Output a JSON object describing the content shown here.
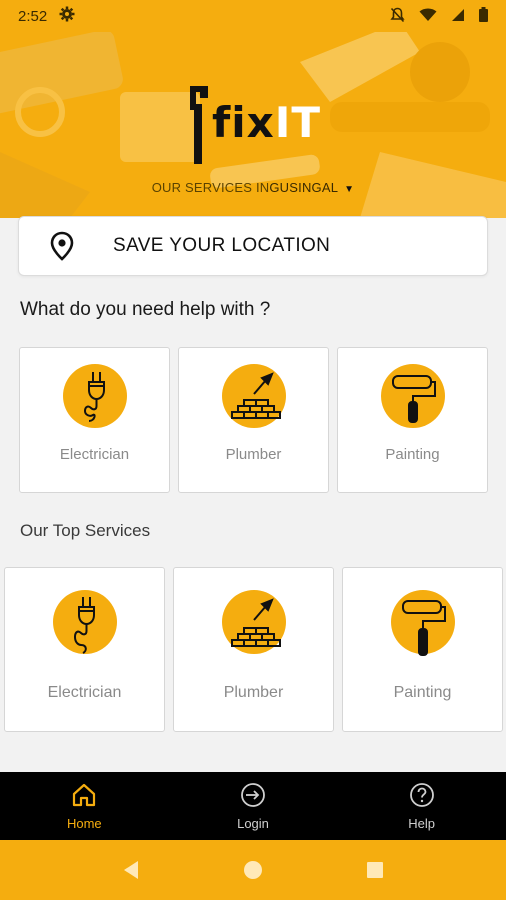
{
  "status_bar": {
    "time": "2:52"
  },
  "brand": {
    "logo_fix": "fix",
    "logo_it": "IT"
  },
  "city": {
    "prefix": "OUR SERVICES IN",
    "name": "GUSINGAL"
  },
  "location": {
    "label": "SAVE YOUR LOCATION"
  },
  "help_section": {
    "title": "What do you need help with ?",
    "items": [
      {
        "label": "Electrician",
        "icon": "plug-icon"
      },
      {
        "label": "Plumber",
        "icon": "trowel-bricks-icon"
      },
      {
        "label": "Painting",
        "icon": "paint-roller-icon"
      }
    ]
  },
  "top_services": {
    "title": "Our Top Services",
    "items": [
      {
        "label": "Electrician",
        "icon": "plug-icon"
      },
      {
        "label": "Plumber",
        "icon": "trowel-bricks-icon"
      },
      {
        "label": "Painting",
        "icon": "paint-roller-icon"
      }
    ]
  },
  "bottom_nav": {
    "items": [
      {
        "label": "Home",
        "icon": "home-icon",
        "active": true
      },
      {
        "label": "Login",
        "icon": "login-icon",
        "active": false
      },
      {
        "label": "Help",
        "icon": "help-icon",
        "active": false
      }
    ]
  },
  "colors": {
    "accent": "#f5ad0f",
    "nav_bg": "#000000",
    "card_border": "#d6d6d6"
  }
}
